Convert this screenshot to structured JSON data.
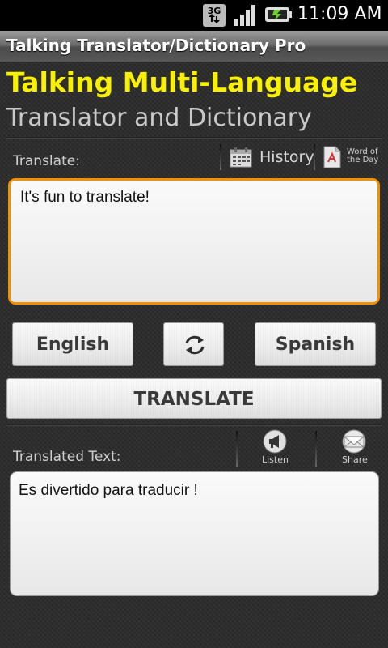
{
  "status_bar": {
    "network": "3G",
    "time": "11:09 AM",
    "icons": [
      "3g-data-icon",
      "signal-strength-icon",
      "battery-charging-icon"
    ]
  },
  "app": {
    "title": "Talking Translator/Dictionary Pro"
  },
  "header": {
    "headline": "Talking Multi-Language",
    "subheadline": "Translator and Dictionary"
  },
  "source": {
    "label": "Translate:",
    "text": "It's fun to translate!",
    "history_label": "History",
    "word_of_day_line1": "Word of",
    "word_of_day_line2": "the Day"
  },
  "languages": {
    "from": "English",
    "to": "Spanish"
  },
  "actions": {
    "translate_label": "TRANSLATE"
  },
  "result": {
    "label": "Translated Text:",
    "text": "Es divertido para traducir !",
    "listen_label": "Listen",
    "share_label": "Share"
  },
  "colors": {
    "headline": "#f9f100",
    "input_focus_border": "#f29100",
    "background": "#2b2b2b"
  }
}
